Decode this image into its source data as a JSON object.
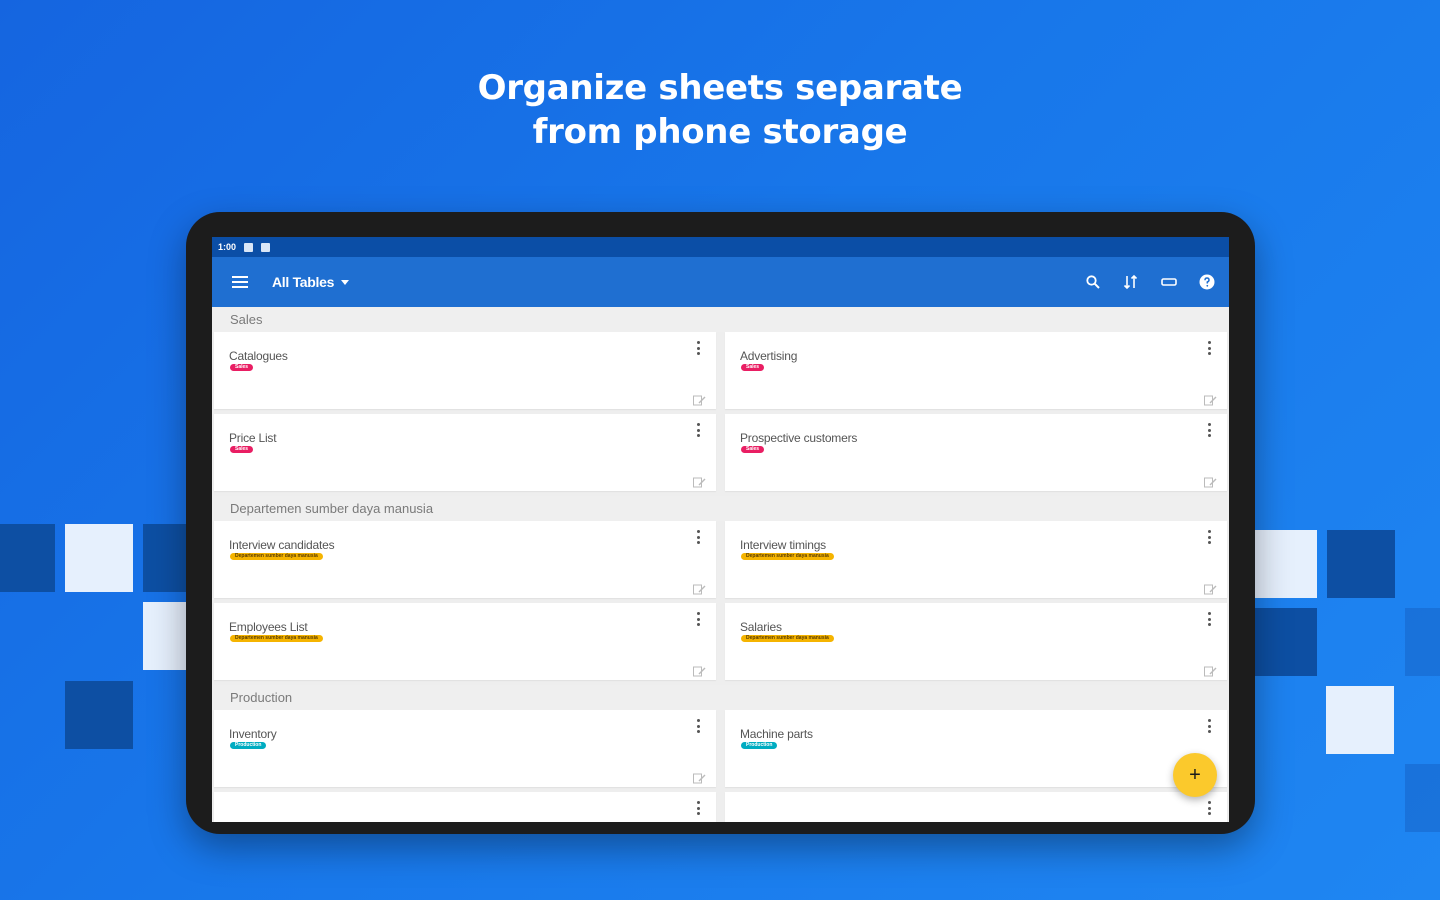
{
  "headline": {
    "line1": "Organize sheets separate",
    "line2": "from phone storage"
  },
  "status_bar": {
    "time": "1:00"
  },
  "app_bar": {
    "title": "All Tables",
    "icons": [
      "menu-icon",
      "search-icon",
      "sort-icon",
      "label-icon",
      "help-icon"
    ]
  },
  "colors": {
    "app_bar": "#1f6fd1",
    "status_bar": "#0b4ea6",
    "tag_sales": "#e91e63",
    "tag_hr": "#f5b400",
    "tag_production": "#00acc1",
    "fab": "#fbc92c"
  },
  "sections": [
    {
      "name": "Sales",
      "rows": [
        [
          {
            "title": "Catalogues",
            "tag": "Sales",
            "tag_type": "sales"
          },
          {
            "title": "Advertising",
            "tag": "Sales",
            "tag_type": "sales"
          }
        ],
        [
          {
            "title": "Price List",
            "tag": "Sales",
            "tag_type": "sales"
          },
          {
            "title": "Prospective customers",
            "tag": "Sales",
            "tag_type": "sales"
          }
        ]
      ]
    },
    {
      "name": "Departemen sumber daya manusia",
      "rows": [
        [
          {
            "title": "Interview candidates",
            "tag": "Departemen sumber daya manusia",
            "tag_type": "hr"
          },
          {
            "title": "Interview timings",
            "tag": "Departemen sumber daya manusia",
            "tag_type": "hr"
          }
        ],
        [
          {
            "title": "Employees List",
            "tag": "Departemen sumber daya manusia",
            "tag_type": "hr"
          },
          {
            "title": "Salaries",
            "tag": "Departemen sumber daya manusia",
            "tag_type": "hr"
          }
        ]
      ]
    },
    {
      "name": "Production",
      "rows": [
        [
          {
            "title": "Inventory",
            "tag": "Production",
            "tag_type": "production"
          },
          {
            "title": "Machine parts",
            "tag": "Production",
            "tag_type": "production"
          }
        ],
        [
          {
            "title": "",
            "tag": "",
            "tag_type": ""
          },
          {
            "title": "",
            "tag": "",
            "tag_type": ""
          }
        ]
      ]
    }
  ],
  "fab": {
    "label": "+"
  }
}
